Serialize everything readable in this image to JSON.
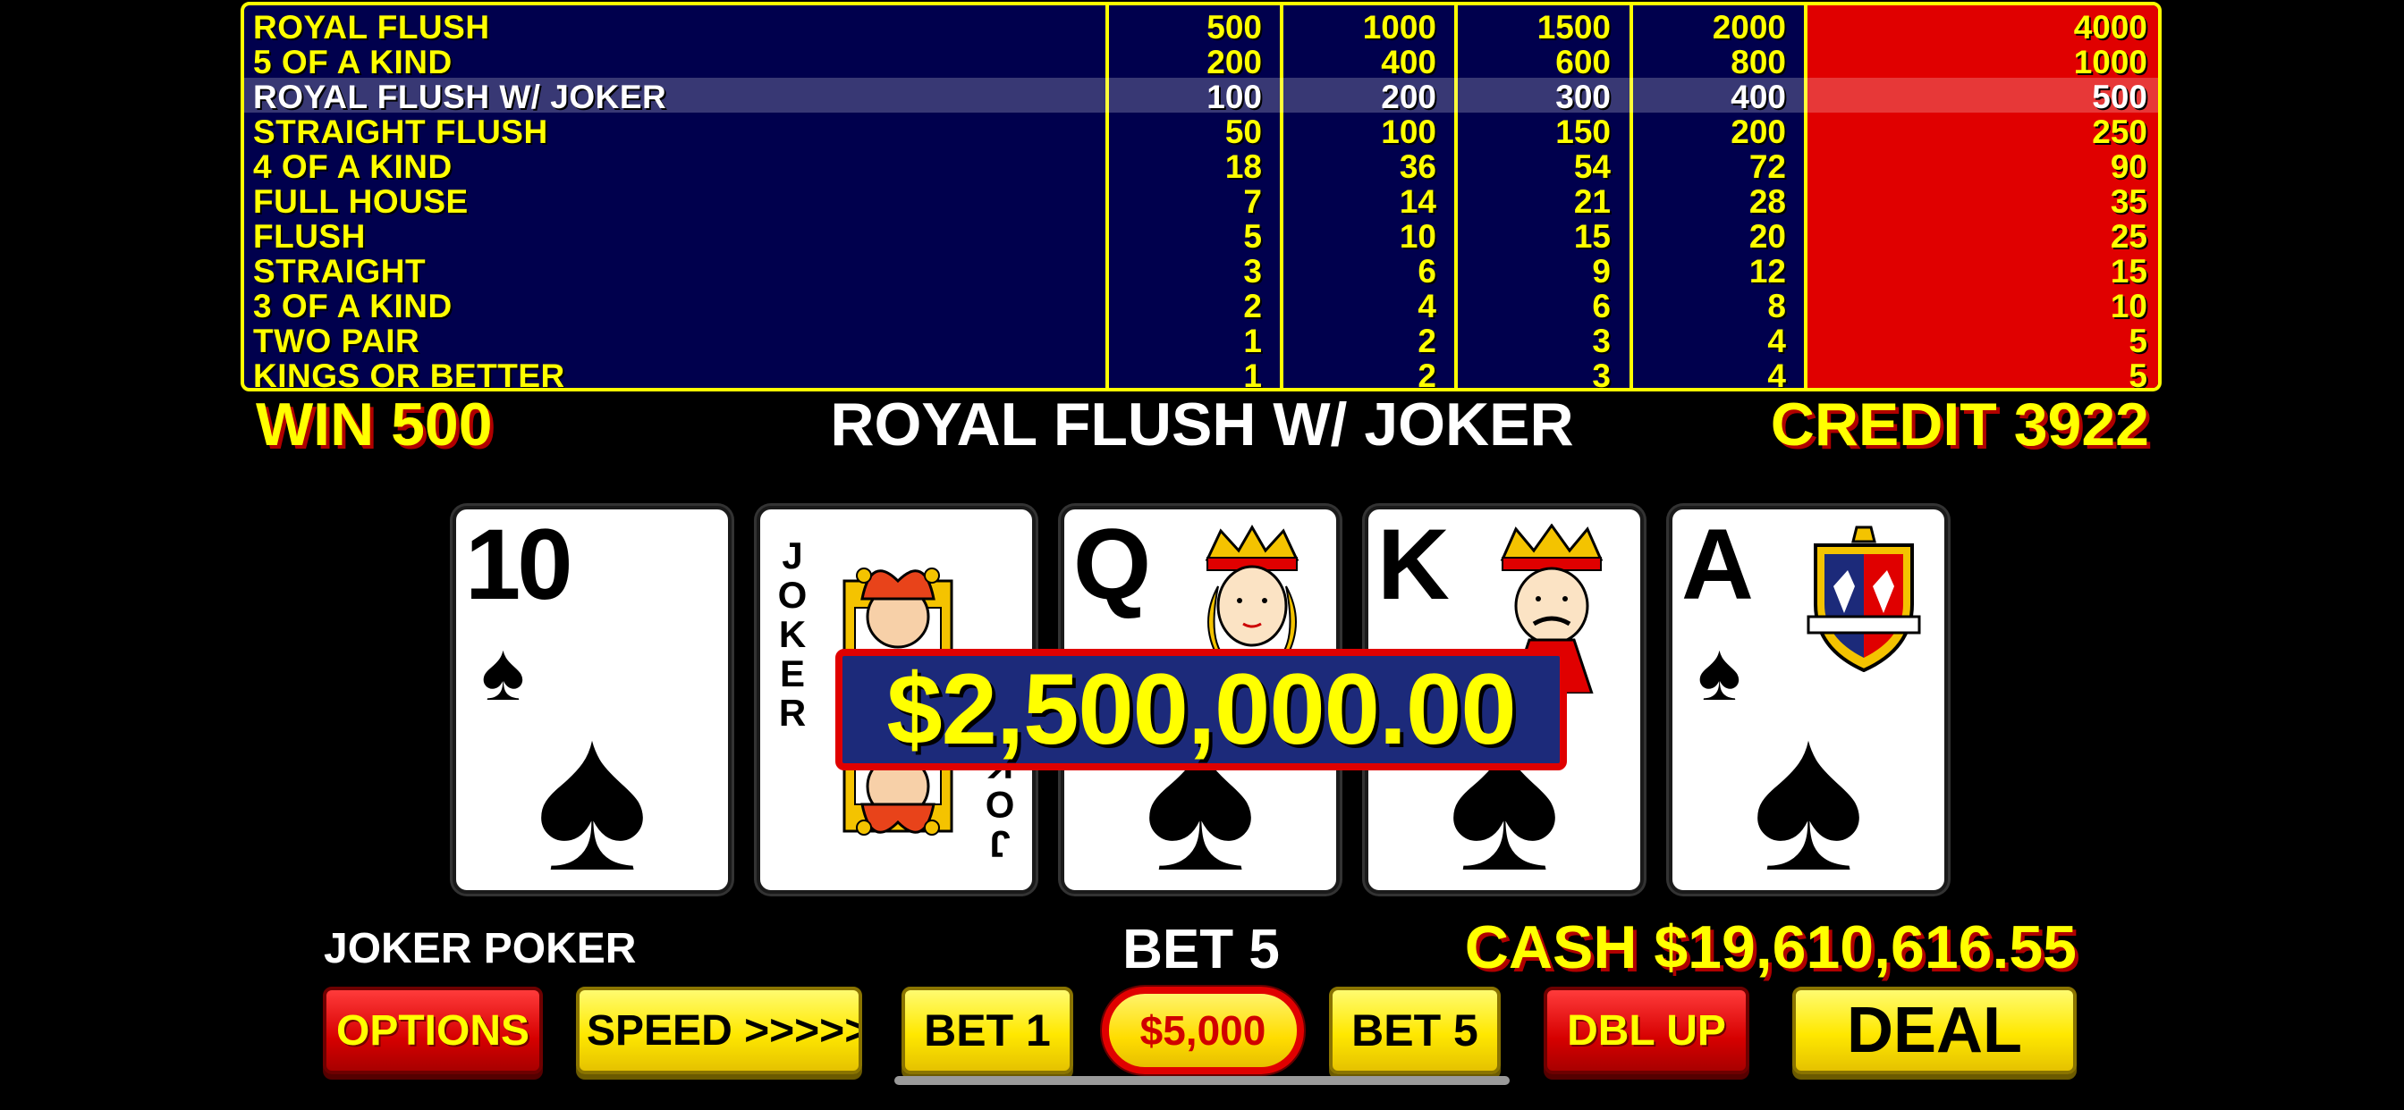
{
  "paytable": {
    "rows": [
      {
        "hand": "ROYAL FLUSH",
        "pays": [
          "500",
          "1000",
          "1500",
          "2000",
          "4000"
        ]
      },
      {
        "hand": "5 OF A KIND",
        "pays": [
          "200",
          "400",
          "600",
          "800",
          "1000"
        ]
      },
      {
        "hand": "ROYAL FLUSH W/ JOKER",
        "pays": [
          "100",
          "200",
          "300",
          "400",
          "500"
        ]
      },
      {
        "hand": "STRAIGHT FLUSH",
        "pays": [
          "50",
          "100",
          "150",
          "200",
          "250"
        ]
      },
      {
        "hand": "4 OF A KIND",
        "pays": [
          "18",
          "36",
          "54",
          "72",
          "90"
        ]
      },
      {
        "hand": "FULL HOUSE",
        "pays": [
          "7",
          "14",
          "21",
          "28",
          "35"
        ]
      },
      {
        "hand": "FLUSH",
        "pays": [
          "5",
          "10",
          "15",
          "20",
          "25"
        ]
      },
      {
        "hand": "STRAIGHT",
        "pays": [
          "3",
          "6",
          "9",
          "12",
          "15"
        ]
      },
      {
        "hand": "3 OF A KIND",
        "pays": [
          "2",
          "4",
          "6",
          "8",
          "10"
        ]
      },
      {
        "hand": "TWO PAIR",
        "pays": [
          "1",
          "2",
          "3",
          "4",
          "5"
        ]
      },
      {
        "hand": "KINGS OR BETTER",
        "pays": [
          "1",
          "2",
          "3",
          "4",
          "5"
        ]
      }
    ],
    "highlighted_row": 2,
    "active_column": 5,
    "colors": {
      "background": "#00004d",
      "border": "#ffff00",
      "active_column": "#e00000",
      "text": "#ffff00",
      "highlight_text": "#ffffff"
    }
  },
  "status": {
    "win": "WIN 500",
    "hand_result": "ROYAL FLUSH W/ JOKER",
    "credit": "CREDIT 3922"
  },
  "cards": [
    {
      "rank": "10",
      "suit": "spade",
      "icon": "spade-icon"
    },
    {
      "rank": "JOKER",
      "suit": "joker",
      "icon": "jester-icon",
      "letters": [
        "J",
        "O",
        "K",
        "E",
        "R"
      ]
    },
    {
      "rank": "Q",
      "suit": "spade",
      "icon": "queen-face-icon"
    },
    {
      "rank": "K",
      "suit": "spade",
      "icon": "king-face-icon"
    },
    {
      "rank": "A",
      "suit": "spade",
      "icon": "crest-icon"
    }
  ],
  "jackpot": "$2,500,000.00",
  "game_name": "JOKER POKER",
  "bet_label": "BET 5",
  "cash": "CASH $19,610,616.55",
  "buttons": {
    "options": "OPTIONS",
    "speed": "SPEED >>>>>",
    "bet1": "BET 1",
    "denomination": "$5,000",
    "bet5": "BET 5",
    "dbl_up": "DBL UP",
    "deal": "DEAL"
  }
}
